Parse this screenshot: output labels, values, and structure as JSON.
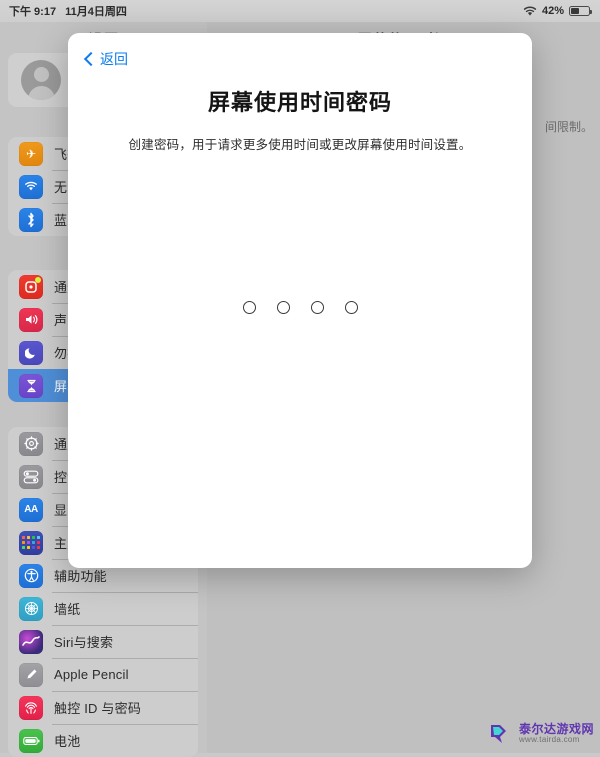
{
  "status_bar": {
    "time": "下午 9:17",
    "date": "11月4日周四",
    "battery_percent": "42%",
    "battery_level": 42,
    "wifi_icon": "wifi-icon",
    "battery_icon": "battery-icon"
  },
  "panes": {
    "left_title": "设置",
    "right_title": "屏幕使用时间",
    "right_text_fragment": "间限制。"
  },
  "apple_id": {
    "avatar_icon": "person-placeholder-icon"
  },
  "sidebar": {
    "groups": [
      {
        "name": "connectivity",
        "items": [
          {
            "label": "飞行模式",
            "icon": "airplane-icon",
            "icon_class": "ic-airplane",
            "glyph": "✈",
            "selected": false
          },
          {
            "label": "无线局域网",
            "icon": "wifi-icon",
            "icon_class": "ic-wifi",
            "glyph": "",
            "selected": false
          },
          {
            "label": "蓝牙",
            "icon": "bluetooth-icon",
            "icon_class": "ic-bluetooth",
            "glyph": "",
            "selected": false
          }
        ]
      },
      {
        "name": "alerts",
        "items": [
          {
            "label": "通知",
            "icon": "notifications-icon",
            "icon_class": "ic-notify",
            "glyph": "",
            "selected": false
          },
          {
            "label": "声音",
            "icon": "sound-icon",
            "icon_class": "ic-sound",
            "glyph": "",
            "selected": false
          },
          {
            "label": "勿扰模式",
            "icon": "moon-icon",
            "icon_class": "ic-dnd",
            "glyph": "",
            "selected": false
          },
          {
            "label": "屏幕使用时间",
            "icon": "hourglass-icon",
            "icon_class": "ic-screentime",
            "glyph": "",
            "selected": true
          }
        ]
      },
      {
        "name": "system",
        "items": [
          {
            "label": "通用",
            "icon": "gear-icon",
            "icon_class": "ic-general",
            "glyph": "",
            "selected": false
          },
          {
            "label": "控制中心",
            "icon": "sliders-icon",
            "icon_class": "ic-control",
            "glyph": "",
            "selected": false
          },
          {
            "label": "显示与亮度",
            "icon": "text-size-icon",
            "icon_class": "ic-display",
            "glyph": "AA",
            "selected": false
          },
          {
            "label": "主屏幕与程序坞",
            "icon": "home-screen-icon",
            "icon_class": "ic-home",
            "glyph": "",
            "selected": false
          },
          {
            "label": "辅助功能",
            "icon": "accessibility-icon",
            "icon_class": "ic-access",
            "glyph": "",
            "selected": false
          },
          {
            "label": "墙纸",
            "icon": "wallpaper-icon",
            "icon_class": "ic-wallpaper",
            "glyph": "",
            "selected": false
          },
          {
            "label": "Siri与搜索",
            "icon": "siri-icon",
            "icon_class": "ic-siri",
            "glyph": "",
            "selected": false
          },
          {
            "label": "Apple Pencil",
            "icon": "pencil-icon",
            "icon_class": "ic-pencil",
            "glyph": "",
            "selected": false
          },
          {
            "label": "触控 ID 与密码",
            "icon": "touch-id-icon",
            "icon_class": "ic-touchid",
            "glyph": "",
            "selected": false
          },
          {
            "label": "电池",
            "icon": "battery-icon",
            "icon_class": "ic-battery",
            "glyph": "",
            "selected": false
          }
        ]
      }
    ]
  },
  "sheet": {
    "back_label": "返回",
    "back_icon": "chevron-left-icon",
    "title": "屏幕使用时间密码",
    "subtitle": "创建密码，用于请求更多使用时间或更改屏幕使用时间设置。",
    "passcode_length": 4,
    "passcode_filled": 0
  },
  "watermark": {
    "name": "泰尔达游戏网",
    "url": "www.tairda.com",
    "color": "#5b2fb0"
  }
}
